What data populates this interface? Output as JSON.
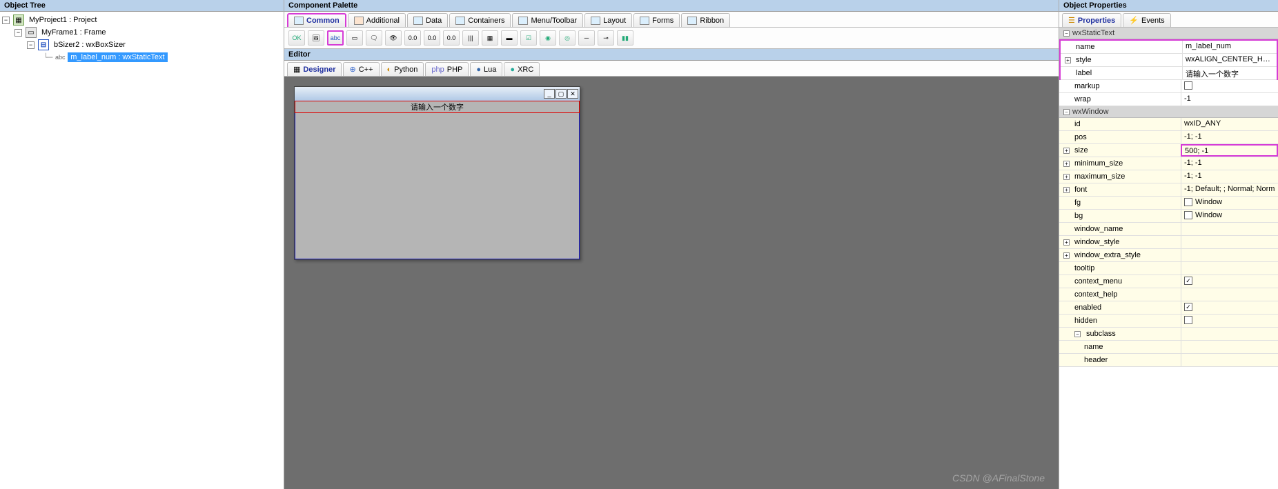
{
  "panels": {
    "object_tree": "Object Tree",
    "component_palette": "Component Palette",
    "editor": "Editor",
    "object_properties": "Object Properties"
  },
  "tree": {
    "project": "MyProject1 : Project",
    "frame": "MyFrame1 : Frame",
    "sizer": "bSizer2 : wxBoxSizer",
    "label": "m_label_num : wxStaticText"
  },
  "palette_tabs": {
    "common": "Common",
    "additional": "Additional",
    "data": "Data",
    "containers": "Containers",
    "menu": "Menu/Toolbar",
    "layout": "Layout",
    "forms": "Forms",
    "ribbon": "Ribbon"
  },
  "editor_tabs": {
    "designer": "Designer",
    "cpp": "C++",
    "python": "Python",
    "php": "PHP",
    "lua": "Lua",
    "xrc": "XRC"
  },
  "form_label": "请输入一个数字",
  "prop_tabs": {
    "properties": "Properties",
    "events": "Events"
  },
  "groups": {
    "static": "wxStaticText",
    "window": "wxWindow"
  },
  "props": {
    "name": {
      "k": "name",
      "v": "m_label_num"
    },
    "style": {
      "k": "style",
      "v": "wxALIGN_CENTER_HORIZO"
    },
    "label": {
      "k": "label",
      "v": "请输入一个数字"
    },
    "markup": {
      "k": "markup",
      "v": ""
    },
    "wrap": {
      "k": "wrap",
      "v": "-1"
    },
    "id": {
      "k": "id",
      "v": "wxID_ANY"
    },
    "pos": {
      "k": "pos",
      "v": "-1; -1"
    },
    "size": {
      "k": "size",
      "v": "500; -1"
    },
    "minimum_size": {
      "k": "minimum_size",
      "v": "-1; -1"
    },
    "maximum_size": {
      "k": "maximum_size",
      "v": "-1; -1"
    },
    "font": {
      "k": "font",
      "v": "-1; Default; ; Normal; Norm"
    },
    "fg": {
      "k": "fg",
      "v": "Window"
    },
    "bg": {
      "k": "bg",
      "v": "Window"
    },
    "window_name": {
      "k": "window_name",
      "v": ""
    },
    "window_style": {
      "k": "window_style",
      "v": ""
    },
    "window_extra_style": {
      "k": "window_extra_style",
      "v": ""
    },
    "tooltip": {
      "k": "tooltip",
      "v": ""
    },
    "context_menu": {
      "k": "context_menu",
      "v": ""
    },
    "context_help": {
      "k": "context_help",
      "v": ""
    },
    "enabled": {
      "k": "enabled",
      "v": ""
    },
    "hidden": {
      "k": "hidden",
      "v": ""
    },
    "subclass": {
      "k": "subclass",
      "v": ""
    },
    "sub_name": {
      "k": "name",
      "v": ""
    },
    "sub_header": {
      "k": "header",
      "v": ""
    }
  },
  "watermark": "CSDN @AFinalStone"
}
